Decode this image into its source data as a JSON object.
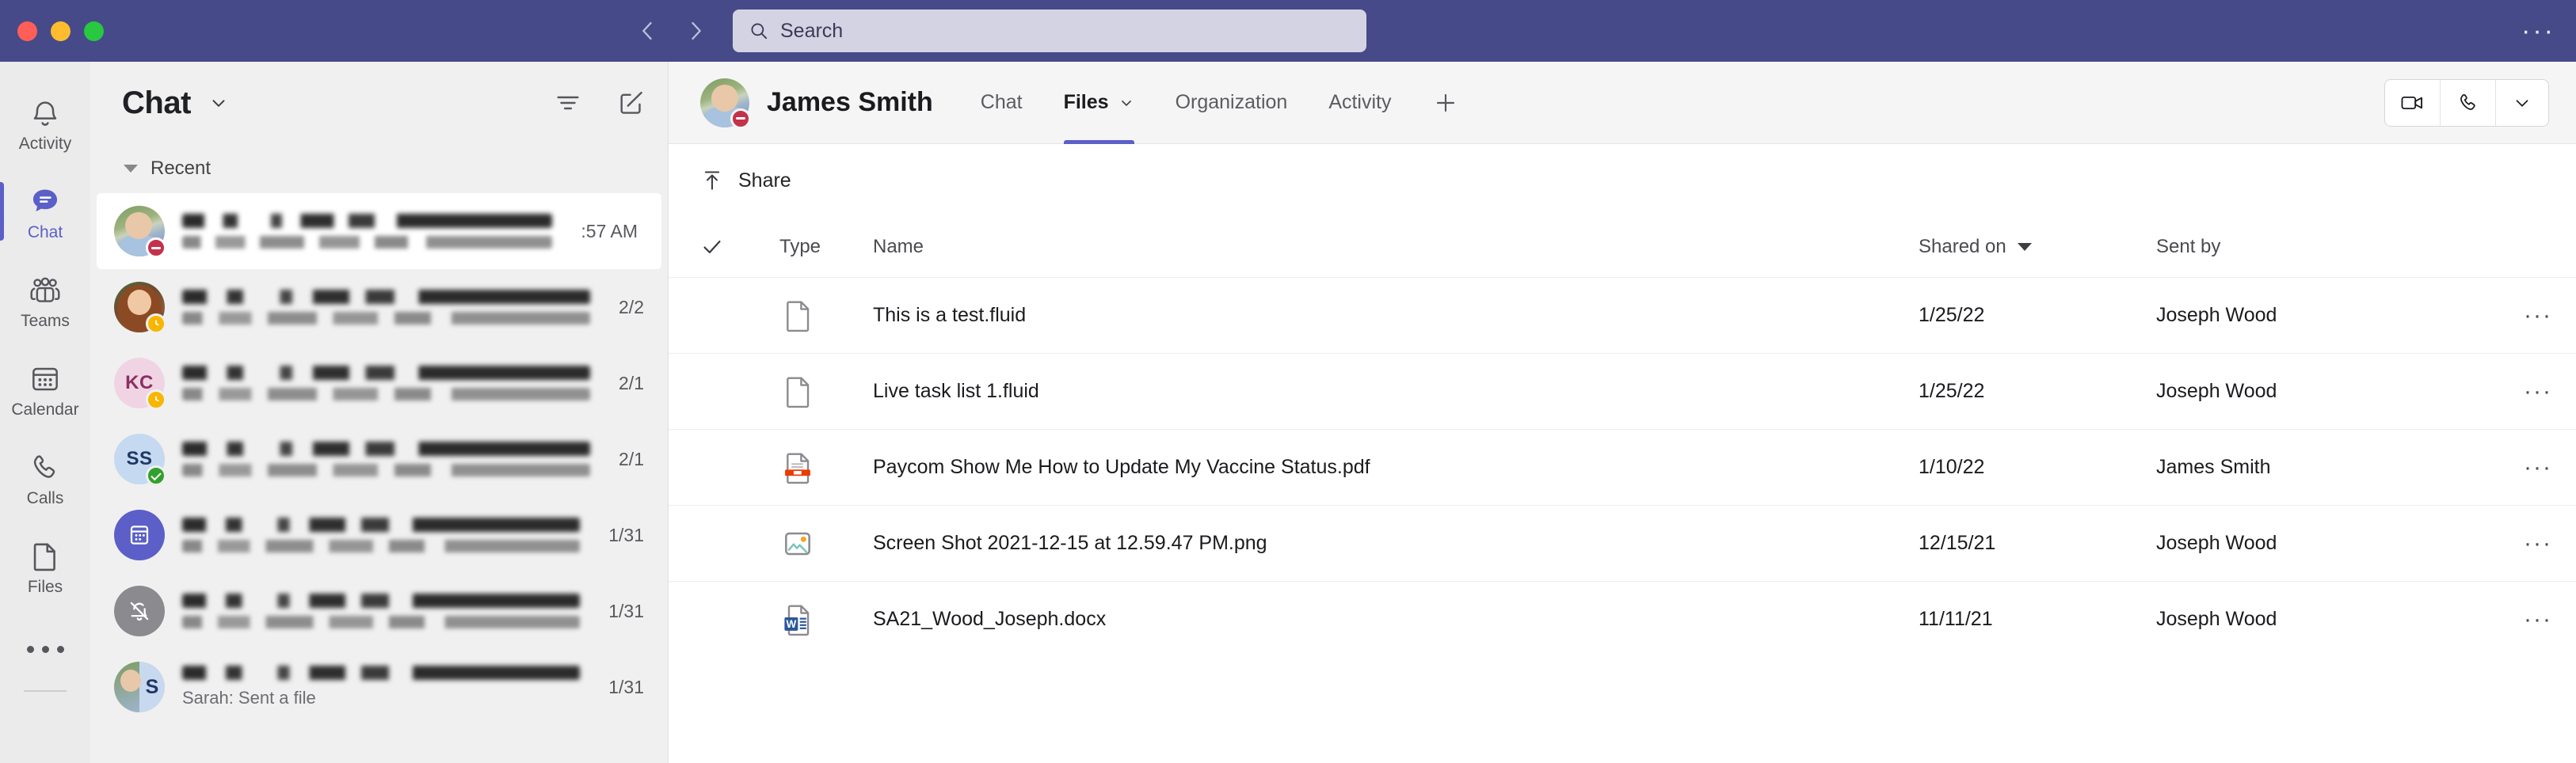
{
  "window": {
    "traffic_lights": [
      "close",
      "minimize",
      "zoom"
    ],
    "nav_back": "back-chevron",
    "nav_forward": "forward-chevron",
    "overflow": "···"
  },
  "search": {
    "placeholder": "Search",
    "value": "",
    "icon": "search-icon"
  },
  "rail": {
    "items": [
      {
        "label": "Activity",
        "icon": "bell-icon",
        "active": false
      },
      {
        "label": "Chat",
        "icon": "chat-bubble-icon",
        "active": true
      },
      {
        "label": "Teams",
        "icon": "teams-people-icon",
        "active": false
      },
      {
        "label": "Calendar",
        "icon": "calendar-icon",
        "active": false
      },
      {
        "label": "Calls",
        "icon": "phone-icon",
        "active": false
      },
      {
        "label": "Files",
        "icon": "file-icon",
        "active": false
      }
    ],
    "more_label": "more-apps-ellipsis"
  },
  "chat_list": {
    "title": "Chat",
    "title_chevron": "chevron-down-icon",
    "filter_icon": "filter-icon",
    "compose_icon": "new-chat-icon",
    "section_label": "Recent",
    "items": [
      {
        "name_redacted": true,
        "preview_redacted": true,
        "time": ":57 AM",
        "avatar": "photo",
        "presence": "dnd",
        "selected": true
      },
      {
        "name_redacted": true,
        "preview_redacted": true,
        "time": "2/2",
        "avatar": "photo2",
        "presence": "away",
        "selected": false
      },
      {
        "name_redacted": true,
        "preview_redacted": true,
        "time": "2/1",
        "avatar": "initials",
        "initials": "KC",
        "avatar_color": "#f0d4e4",
        "initials_color": "#8c2f62",
        "presence": "away",
        "selected": false
      },
      {
        "name_redacted": true,
        "preview_redacted": true,
        "time": "2/1",
        "avatar": "initials",
        "initials": "SS",
        "avatar_color": "#c5d9f1",
        "initials_color": "#1f3864",
        "presence": "avail",
        "selected": false
      },
      {
        "name_redacted": true,
        "preview_redacted": true,
        "time": "1/31",
        "avatar": "meeting",
        "avatar_color": "#5b5fc7",
        "presence": "none",
        "selected": false
      },
      {
        "name_redacted": true,
        "preview_redacted": true,
        "time": "1/31",
        "avatar": "muted",
        "avatar_color": "#8a8a8f",
        "presence": "none",
        "selected": false
      },
      {
        "name_redacted": true,
        "preview": "Sarah: Sent a file",
        "time": "1/31",
        "avatar": "split",
        "split_initial": "S",
        "presence": "none",
        "selected": false
      }
    ]
  },
  "conversation": {
    "person": "James Smith",
    "presence": "dnd",
    "tabs": [
      {
        "label": "Chat",
        "active": false,
        "has_chevron": false
      },
      {
        "label": "Files",
        "active": true,
        "has_chevron": true
      },
      {
        "label": "Organization",
        "active": false,
        "has_chevron": false
      },
      {
        "label": "Activity",
        "active": false,
        "has_chevron": false
      }
    ],
    "add_tab_icon": "plus-icon",
    "actions": [
      {
        "name": "video-call",
        "icon": "video-camera-icon"
      },
      {
        "name": "audio-call",
        "icon": "phone-icon"
      },
      {
        "name": "call-options",
        "icon": "chevron-down-icon"
      }
    ]
  },
  "files": {
    "toolbar": {
      "share_label": "Share",
      "share_icon": "upload-arrow-icon"
    },
    "columns": {
      "select_all": "checkmark-icon",
      "type": "Type",
      "name": "Name",
      "shared_on": "Shared on",
      "shared_on_sort": "descending",
      "sent_by": "Sent by"
    },
    "rows": [
      {
        "icon": "fluid-file-icon",
        "name": "This is a test.fluid",
        "shared_on": "1/25/22",
        "sent_by": "Joseph Wood",
        "more": "···"
      },
      {
        "icon": "fluid-file-icon",
        "name": "Live task list 1.fluid",
        "shared_on": "1/25/22",
        "sent_by": "Joseph Wood",
        "more": "···"
      },
      {
        "icon": "pdf-file-icon",
        "name": "Paycom Show Me How to Update My Vaccine Status.pdf",
        "shared_on": "1/10/22",
        "sent_by": "James Smith",
        "more": "···"
      },
      {
        "icon": "image-file-icon",
        "name": "Screen Shot 2021-12-15 at 12.59.47 PM.png",
        "shared_on": "12/15/21",
        "sent_by": "Joseph Wood",
        "more": "···"
      },
      {
        "icon": "word-file-icon",
        "name": "SA21_Wood_Joseph.docx",
        "shared_on": "11/11/21",
        "sent_by": "Joseph Wood",
        "more": "···"
      }
    ]
  },
  "colors": {
    "titlebar": "#464a88",
    "accent": "#5b5fc7",
    "rail_bg": "#ebebeb",
    "chatlist_bg": "#f0f0f0",
    "dnd": "#c4314b",
    "away": "#f8b600",
    "available": "#32a02d"
  }
}
